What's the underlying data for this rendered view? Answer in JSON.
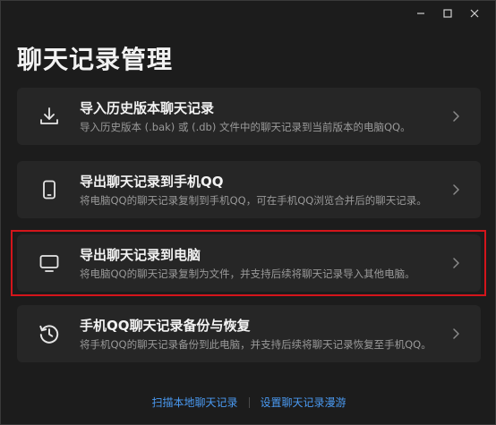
{
  "window": {
    "title": "聊天记录管理",
    "controls": [
      "minimize-icon",
      "maximize-icon",
      "close-icon"
    ]
  },
  "cards": [
    {
      "icon": "download-icon",
      "title": "导入历史版本聊天记录",
      "desc": "导入历史版本 (.bak) 或 (.db) 文件中的聊天记录到当前版本的电脑QQ。"
    },
    {
      "icon": "phone-icon",
      "title": "导出聊天记录到手机QQ",
      "desc": "将电脑QQ的聊天记录复制到手机QQ，可在手机QQ浏览合并后的聊天记录。"
    },
    {
      "icon": "monitor-icon",
      "title": "导出聊天记录到电脑",
      "desc": "将电脑QQ的聊天记录复制为文件，并支持后续将聊天记录导入其他电脑。"
    },
    {
      "icon": "history-icon",
      "title": "手机QQ聊天记录备份与恢复",
      "desc": "将手机QQ的聊天记录备份到此电脑，并支持后续将聊天记录恢复至手机QQ。"
    }
  ],
  "footer": {
    "scan_local": "扫描本地聊天记录",
    "roaming_settings": "设置聊天记录漫游"
  },
  "colors": {
    "background": "#1c1c1c",
    "card": "#262626",
    "link": "#4a9af2",
    "highlight": "#d4151b"
  }
}
